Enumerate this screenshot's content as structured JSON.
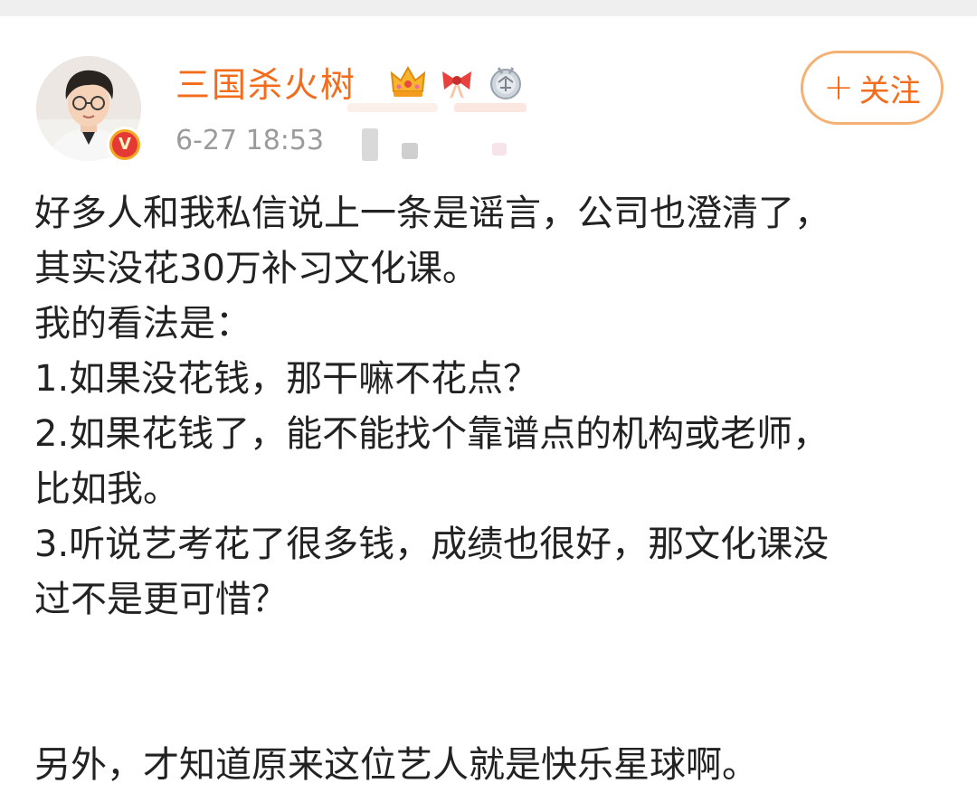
{
  "post": {
    "author": {
      "name": "三国杀火树",
      "verified_mark": "V",
      "badges": [
        "crown-icon",
        "bow-icon",
        "medal-icon"
      ]
    },
    "timestamp": "6-27 18:53",
    "follow_label": "关注",
    "follow_plus": "+",
    "lines": [
      "好多人和我私信说上一条是谣言，公司也澄清了，",
      "其实没花30万补习文化课。",
      "我的看法是：",
      "1.如果没花钱，那干嘛不花点？",
      "2.如果花钱了，能不能找个靠谱点的机构或老师，",
      "比如我。",
      "3.听说艺考花了很多钱，成绩也很好，那文化课没",
      "过不是更可惜？",
      "",
      "另外，才知道原来这位艺人就是快乐星球啊。"
    ]
  },
  "colors": {
    "accent": "#f26c1c",
    "follow_border": "#f5b074",
    "text": "#222222",
    "meta_text": "#9b9b9b",
    "verified_bg": "#f5a623",
    "verified_inner": "#e53935"
  }
}
